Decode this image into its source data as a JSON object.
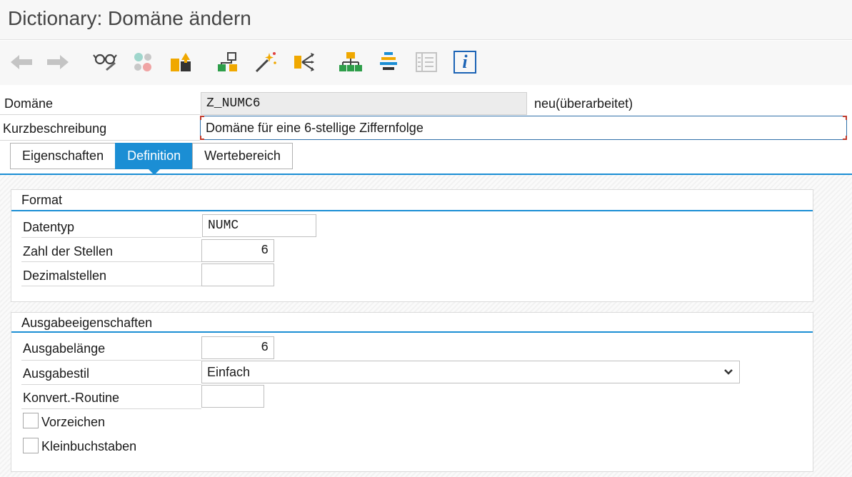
{
  "window": {
    "title": "Dictionary: Domäne ändern"
  },
  "toolbar": {
    "icons": [
      "back-arrow-icon",
      "forward-arrow-icon",
      "glasses-display-icon",
      "toggle-change-icon",
      "activate-icon",
      "hierarchy-icon",
      "magic-wand-icon",
      "where-used-icon",
      "structure-tree-icon",
      "align-center-icon",
      "list-view-icon",
      "info-icon"
    ],
    "info_label": "i"
  },
  "header": {
    "domain_label": "Domäne",
    "domain_value": "Z_NUMC6",
    "status_text": "neu(überarbeitet)",
    "short_desc_label": "Kurzbeschreibung",
    "short_desc_value": "Domäne für eine 6-stellige Ziffernfolge"
  },
  "tabs": [
    {
      "label": "Eigenschaften",
      "active": false
    },
    {
      "label": "Definition",
      "active": true
    },
    {
      "label": "Wertebereich",
      "active": false
    }
  ],
  "format": {
    "title": "Format",
    "datatype_label": "Datentyp",
    "datatype_value": "NUMC",
    "digits_label": "Zahl der Stellen",
    "digits_value": "6",
    "decimals_label": "Dezimalstellen",
    "decimals_value": ""
  },
  "output": {
    "title": "Ausgabeeigenschaften",
    "length_label": "Ausgabelänge",
    "length_value": "6",
    "style_label": "Ausgabestil",
    "style_value": "Einfach",
    "conv_label": "Konvert.-Routine",
    "conv_value": "",
    "sign_label": "Vorzeichen",
    "sign_checked": false,
    "lowercase_label": "Kleinbuchstaben",
    "lowercase_checked": false
  },
  "colors": {
    "accent": "#1b8ed4",
    "focus_corner": "#c0392b"
  }
}
